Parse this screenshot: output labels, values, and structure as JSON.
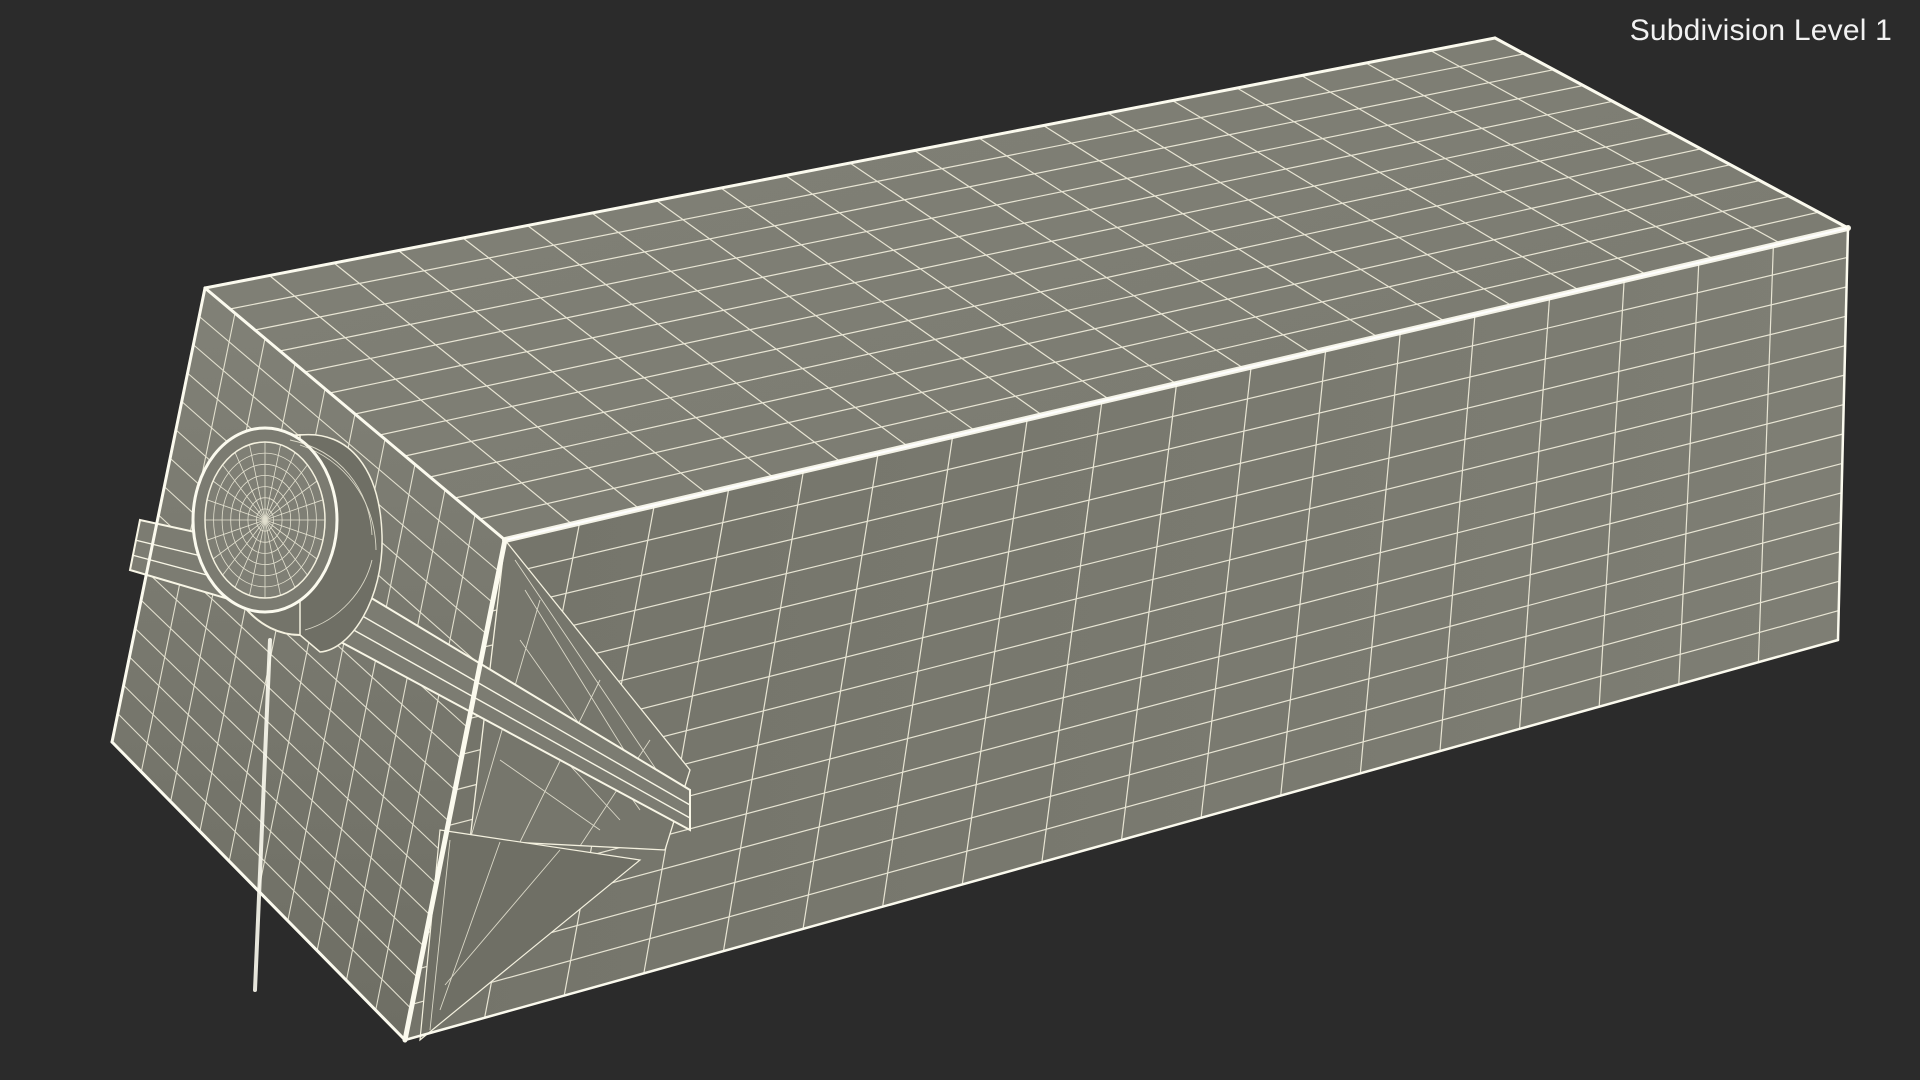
{
  "overlay": {
    "label": "Subdivision Level 1"
  },
  "scene": {
    "subject_icon": "wireframe-carton-icon",
    "background_color": "#2b2b2b",
    "surface_color": "#7d7d72",
    "surface_dark_color": "#6f6f65",
    "wire_color": "#f4f1df"
  }
}
